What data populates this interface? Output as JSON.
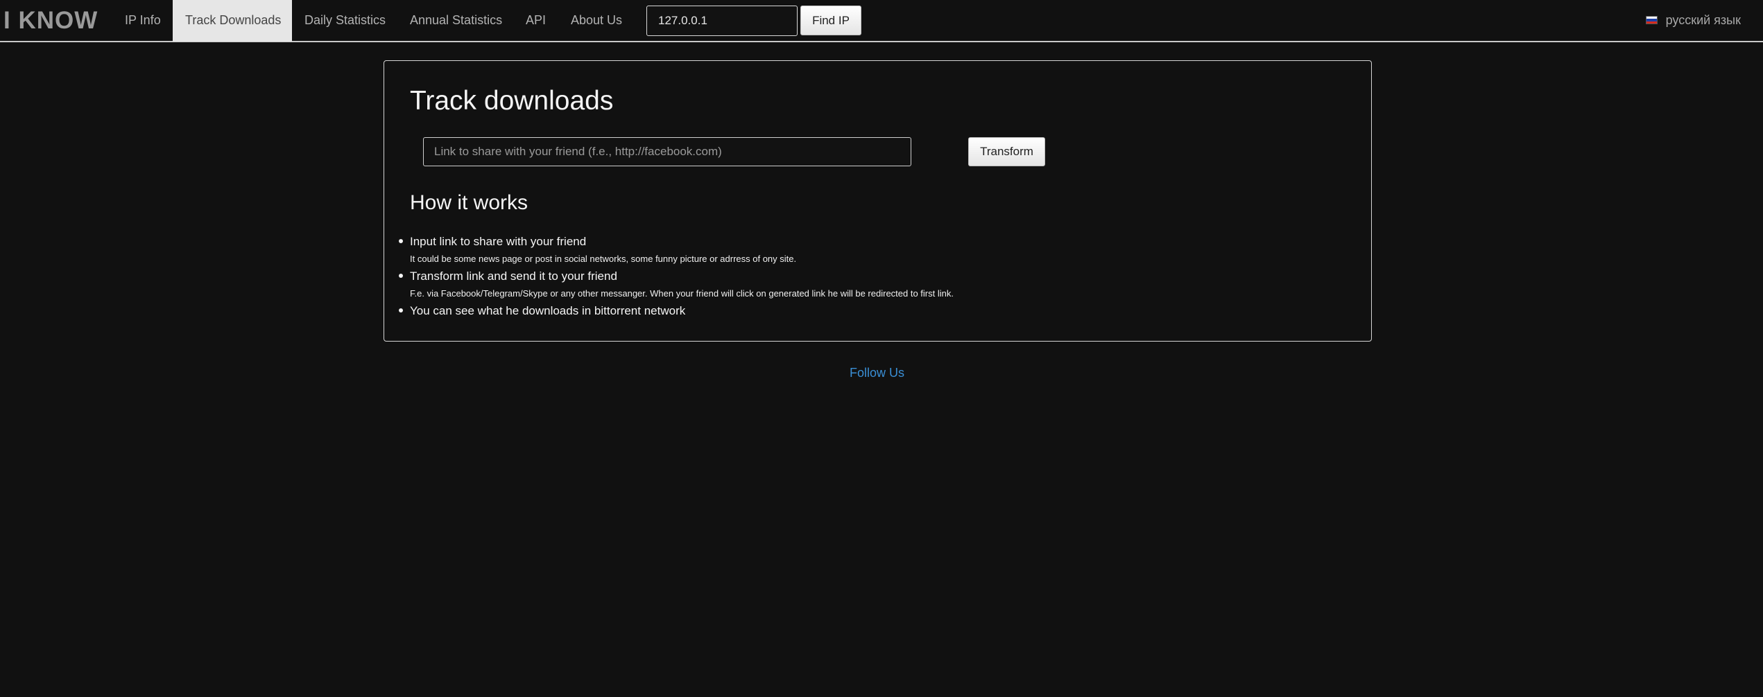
{
  "navbar": {
    "brand": "I KNOW",
    "items": [
      {
        "label": "IP Info",
        "active": false
      },
      {
        "label": "Track Downloads",
        "active": true
      },
      {
        "label": "Daily Statistics",
        "active": false
      },
      {
        "label": "Annual Statistics",
        "active": false
      },
      {
        "label": "API",
        "active": false
      },
      {
        "label": "About Us",
        "active": false
      }
    ],
    "ip_value": "127.0.0.1",
    "find_button": "Find IP",
    "language": "русский язык",
    "language_icon": "russian-flag-icon"
  },
  "main": {
    "title": "Track downloads",
    "link_placeholder": "Link to share with your friend (f.e., http://facebook.com)",
    "link_value": "",
    "transform_button": "Transform",
    "how_title": "How it works",
    "steps": [
      {
        "title": "Input link to share with your friend",
        "description": "It could be some news page or post in social networks, some funny picture or adrress of ony site."
      },
      {
        "title": "Transform link and send it to your friend",
        "description": "F.e. via Facebook/Telegram/Skype or any other messanger. When your friend will click on generated link he will be redirected to first link."
      },
      {
        "title": "You can see what he downloads in bittorrent network",
        "description": ""
      }
    ]
  },
  "footer": {
    "follow_label": "Follow Us",
    "link_color": "#3a8fd6"
  },
  "colors": {
    "background": "#111111",
    "active_tab_bg": "#e6e6e6",
    "nav_text": "#b3b3b3"
  }
}
